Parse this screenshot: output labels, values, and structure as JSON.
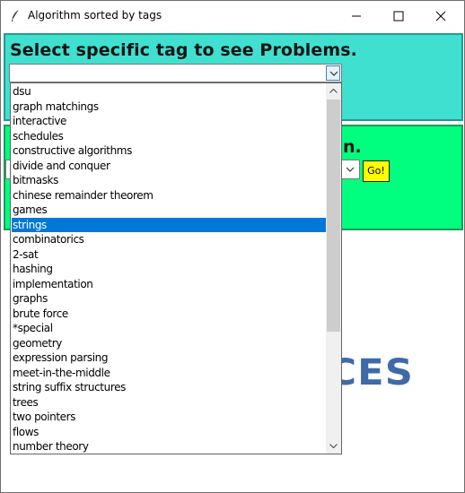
{
  "window": {
    "title": "Algorithm sorted by tags"
  },
  "top_panel": {
    "heading": "Select specific tag to see Problems.",
    "combo_value": ""
  },
  "mid_panel": {
    "heading_visible": "n.",
    "go_label": "Go!"
  },
  "logo_text": "RCES",
  "dropdown": {
    "items": [
      "dsu",
      "graph matchings",
      "interactive",
      "schedules",
      "constructive algorithms",
      "divide and conquer",
      "bitmasks",
      "chinese remainder theorem",
      "games",
      "strings",
      "combinatorics",
      "2-sat",
      "hashing",
      "implementation",
      "graphs",
      "brute force",
      "*special",
      "geometry",
      "expression parsing",
      "meet-in-the-middle",
      "string suffix structures",
      "trees",
      "two pointers",
      "flows",
      "number theory"
    ],
    "selected_index": 9,
    "scroll_position": 0
  },
  "colors": {
    "top_panel_bg": "#40e0d0",
    "mid_panel_bg": "#00ff7f",
    "go_button_bg": "#ffff00",
    "selection": "#0078d7",
    "logo": "#3f6aa8"
  },
  "icons": {
    "app": "feather-icon",
    "minimize": "minimize-icon",
    "maximize": "maximize-icon",
    "close": "close-icon",
    "dropdown_arrow": "chevron-down-icon",
    "scroll_up": "chevron-up-icon",
    "scroll_down": "chevron-down-icon"
  }
}
